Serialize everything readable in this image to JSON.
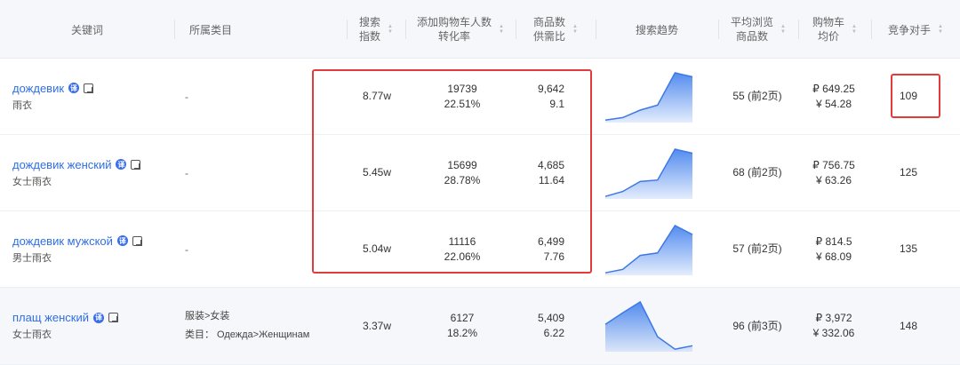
{
  "headers": {
    "keyword": "关键词",
    "category": "所属类目",
    "search_index": [
      "搜索",
      "指数"
    ],
    "cart": [
      "添加购物车人数",
      "转化率"
    ],
    "supply": [
      "商品数",
      "供需比"
    ],
    "trend": "搜索趋势",
    "views": [
      "平均浏览",
      "商品数"
    ],
    "price": [
      "购物车",
      "均价"
    ],
    "competitors": "竞争对手"
  },
  "icons": {
    "translate": "translate-icon",
    "copy": "copy-icon",
    "sort": "sort-icon"
  },
  "translate_badge": "译",
  "colors": {
    "link": "#2f6fe4",
    "highlight": "#e23b3b",
    "trend": "#4a86ee"
  },
  "rows": [
    {
      "keyword": "дождевик",
      "translation": "雨衣",
      "category_dash": "-",
      "category_path": "",
      "category_label": "",
      "search_index": "8.77w",
      "cart_count": "19739",
      "conversion": "22.51%",
      "goods": "9,642",
      "ratio": "9.1",
      "trend": [
        0.05,
        0.1,
        0.25,
        0.35,
        1.0,
        0.92
      ],
      "views": "55 (前2页)",
      "price_rub": "₽ 649.25",
      "price_cny": "¥ 54.28",
      "competitors": "109"
    },
    {
      "keyword": "дождевик женский",
      "translation": "女士雨衣",
      "category_dash": "-",
      "category_path": "",
      "category_label": "",
      "search_index": "5.45w",
      "cart_count": "15699",
      "conversion": "28.78%",
      "goods": "4,685",
      "ratio": "11.64",
      "trend": [
        0.05,
        0.15,
        0.35,
        0.38,
        1.0,
        0.92
      ],
      "views": "68 (前2页)",
      "price_rub": "₽ 756.75",
      "price_cny": "¥ 63.26",
      "competitors": "125"
    },
    {
      "keyword": "дождевик мужской",
      "translation": "男士雨衣",
      "category_dash": "-",
      "category_path": "",
      "category_label": "",
      "search_index": "5.04w",
      "cart_count": "11116",
      "conversion": "22.06%",
      "goods": "6,499",
      "ratio": "7.76",
      "trend": [
        0.05,
        0.12,
        0.4,
        0.45,
        1.0,
        0.82
      ],
      "views": "57 (前2页)",
      "price_rub": "₽ 814.5",
      "price_cny": "¥ 68.09",
      "competitors": "135"
    },
    {
      "keyword": "плащ женский",
      "translation": "女士雨衣",
      "category_dash": "",
      "category_path": "服装>女装",
      "category_label": "类目： Одежда>Женщинам",
      "search_index": "3.37w",
      "cart_count": "6127",
      "conversion": "18.2%",
      "goods": "5,409",
      "ratio": "6.22",
      "trend": [
        0.55,
        0.78,
        1.0,
        0.3,
        0.05,
        0.12
      ],
      "views": "96 (前3页)",
      "price_rub": "₽ 3,972",
      "price_cny": "¥ 332.06",
      "competitors": "148"
    }
  ]
}
